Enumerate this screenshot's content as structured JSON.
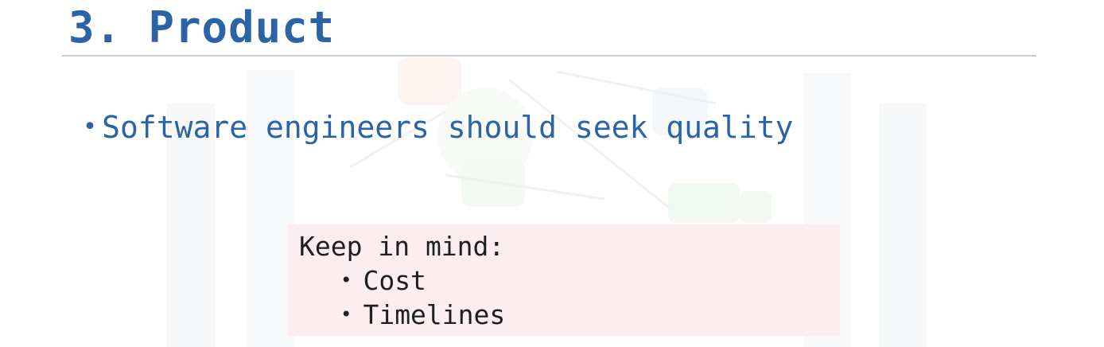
{
  "slide": {
    "title": "3. Product",
    "bullets": [
      {
        "marker": "•",
        "text": "Software engineers should seek quality"
      }
    ],
    "note": {
      "heading": "Keep in mind:",
      "items": [
        {
          "marker": "•",
          "text": "Cost"
        },
        {
          "marker": "•",
          "text": "Timelines"
        }
      ]
    }
  },
  "colors": {
    "title": "#2a63a6",
    "rule": "#c9ccd2",
    "note_background": "#fcedf0",
    "note_text": "#1f1f1f"
  },
  "background_watermark": "faint-diagram-watermark"
}
